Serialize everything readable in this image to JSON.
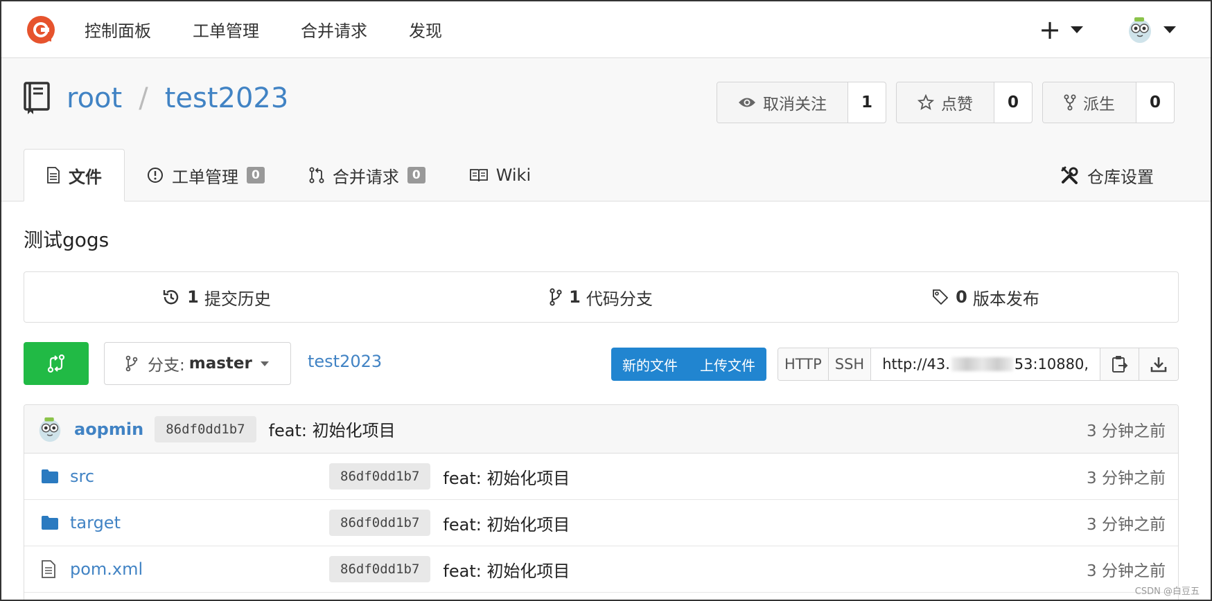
{
  "nav": {
    "items": [
      "控制面板",
      "工单管理",
      "合并请求",
      "发现"
    ],
    "plus": "+"
  },
  "repo": {
    "owner": "root",
    "separator": "/",
    "name": "test2023",
    "watch": {
      "label": "取消关注",
      "count": "1"
    },
    "star": {
      "label": "点赞",
      "count": "0"
    },
    "fork": {
      "label": "派生",
      "count": "0"
    }
  },
  "tabs": {
    "files": "文件",
    "issues": "工单管理",
    "issues_count": "0",
    "pulls": "合并请求",
    "pulls_count": "0",
    "wiki": "Wiki",
    "settings": "仓库设置"
  },
  "description": "测试gogs",
  "stats": {
    "commits_count": "1",
    "commits_label": "提交历史",
    "branches_count": "1",
    "branches_label": "代码分支",
    "releases_count": "0",
    "releases_label": "版本发布"
  },
  "toolbar": {
    "branch_prefix": "分支:",
    "branch": "master",
    "path": "test2023",
    "new_file": "新的文件",
    "upload_file": "上传文件",
    "http": "HTTP",
    "ssh": "SSH",
    "url_start": "http://43.",
    "url_end": "53:10880,"
  },
  "latest_commit": {
    "author": "aopmin",
    "sha": "86df0dd1b7",
    "message": "feat: 初始化项目",
    "time": "3 分钟之前"
  },
  "files": [
    {
      "name": "src",
      "type": "folder",
      "sha": "86df0dd1b7",
      "message": "feat: 初始化项目",
      "time": "3 分钟之前"
    },
    {
      "name": "target",
      "type": "folder",
      "sha": "86df0dd1b7",
      "message": "feat: 初始化项目",
      "time": "3 分钟之前"
    },
    {
      "name": "pom.xml",
      "type": "file",
      "sha": "86df0dd1b7",
      "message": "feat: 初始化项目",
      "time": "3 分钟之前"
    }
  ],
  "watermark": "CSDN @白豆五",
  "colors": {
    "link": "#4183c4",
    "green": "#21ba45",
    "blue": "#2185d0",
    "logo": "#e6532d"
  }
}
